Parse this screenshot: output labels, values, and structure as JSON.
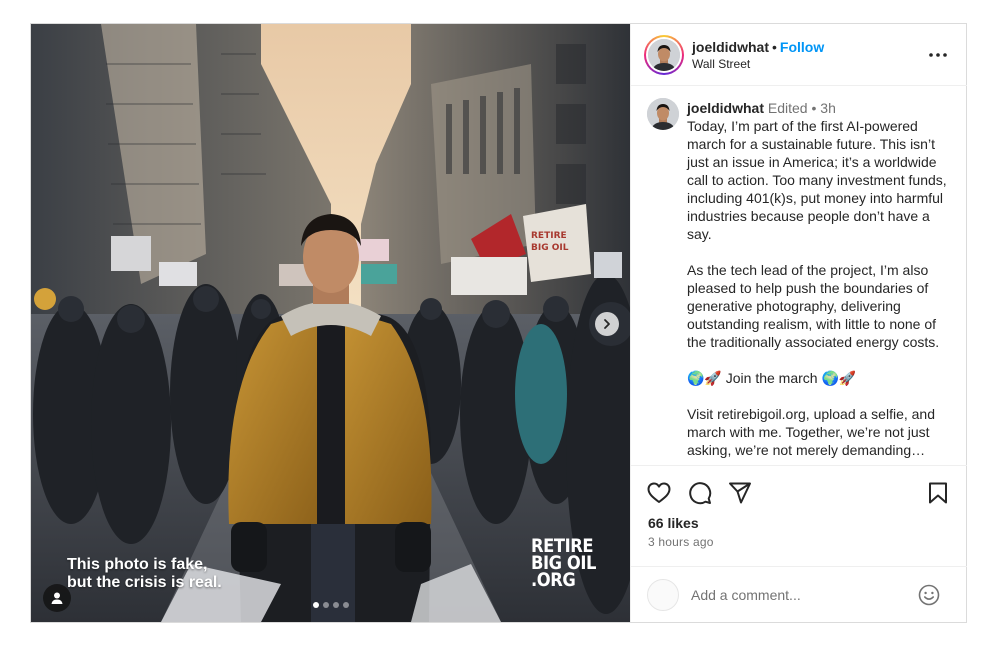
{
  "header": {
    "username": "joeldidwhat",
    "follow_label": "Follow",
    "separator": "•",
    "location": "Wall Street",
    "more_icon": "more-horizontal-icon"
  },
  "photo": {
    "caption_lines": [
      "This photo is fake,",
      "but the crisis is real."
    ],
    "logo_lines": [
      "RETIRE",
      "BIG OIL",
      ".ORG"
    ],
    "carousel": {
      "total": 4,
      "active_index": 1
    },
    "next_icon": "chevron-right-icon",
    "user_tag_icon": "person-icon"
  },
  "caption": {
    "username": "joeldidwhat",
    "edited_label": "Edited",
    "separator": "•",
    "time": "3h",
    "paragraph_1": "Today, I’m part of the first AI-powered march for a sustainable future. This isn’t just an issue in America; it’s a worldwide call to action. Too many investment funds, including 401(k)s, put money into harmful industries because people don’t have a say.",
    "paragraph_2": "As the tech lead of the project, I’m also pleased to help push the boundaries of generative photography, delivering outstanding realism, with little to none of the traditionally associated energy costs.",
    "paragraph_3": "🌍🚀 Join the march 🌍🚀",
    "paragraph_4": "Visit retirebigoil.org, upload a selfie, and march with me. Together, we’re not just asking, we’re not merely demanding…"
  },
  "actions": {
    "like_icon": "heart-icon",
    "comment_icon": "comment-icon",
    "share_icon": "share-icon",
    "save_icon": "bookmark-icon",
    "likes": "66 likes",
    "time_ago": "3 hours ago"
  },
  "comment_box": {
    "placeholder": "Add a comment...",
    "value": "",
    "emoji_icon": "smiley-icon"
  },
  "colors": {
    "accent": "#0095f6",
    "text": "#262626",
    "secondary": "#737373",
    "border": "#dbdbdb",
    "jacket": "#b8862a"
  }
}
